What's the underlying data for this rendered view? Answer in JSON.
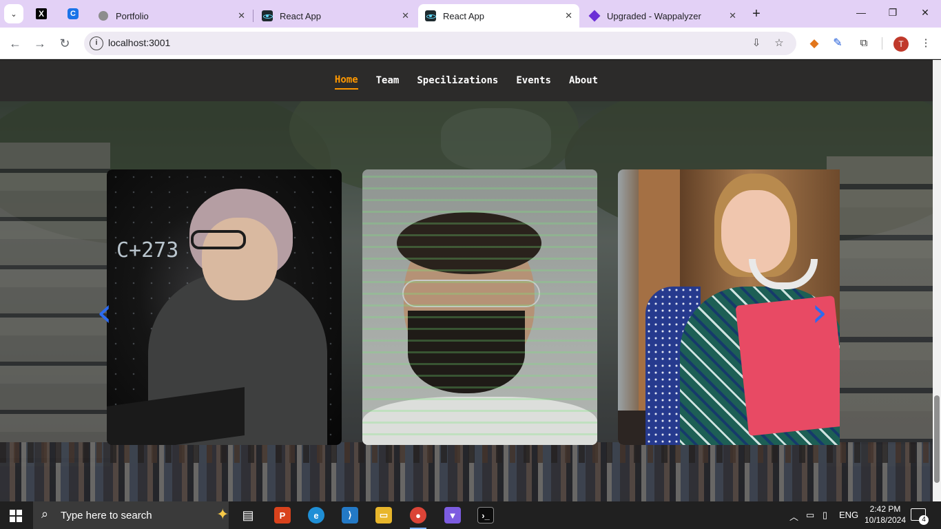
{
  "browser": {
    "tabs": [
      {
        "title": "Portfolio"
      },
      {
        "title": "React App"
      },
      {
        "title": "React App"
      },
      {
        "title": "Upgraded - Wappalyzer"
      }
    ],
    "pinned": [
      "X",
      "C"
    ],
    "url": "localhost:3001",
    "profile_initial": "T"
  },
  "site": {
    "nav": [
      {
        "label": "Home",
        "active": true
      },
      {
        "label": "Team"
      },
      {
        "label": "Specilizations"
      },
      {
        "label": "Events"
      },
      {
        "label": "About"
      }
    ],
    "accent_color": "#ff9800",
    "nav_background": "#2c2b2a",
    "carousel": {
      "arrow_color": "#2c6bf0",
      "slides": [
        {
          "name": "hacker-girl-glasses-photo",
          "text_overlay": "C+273"
        },
        {
          "name": "man-binary-projection-photo"
        },
        {
          "name": "student-girl-folder-photo"
        }
      ]
    }
  },
  "taskbar": {
    "search_placeholder": "Type here to search",
    "language": "ENG",
    "time": "2:42 PM",
    "date": "10/18/2024",
    "notification_count": "4",
    "apps": [
      "task-view-icon",
      "pdf-app-icon",
      "edge-icon",
      "vscode-icon",
      "file-explorer-icon",
      "chrome-icon",
      "app-icon",
      "terminal-icon"
    ]
  }
}
